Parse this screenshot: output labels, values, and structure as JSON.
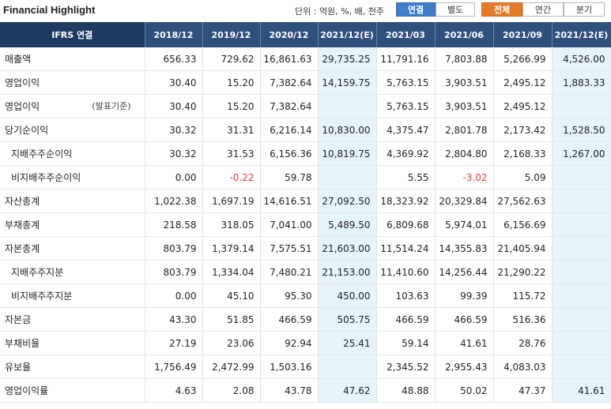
{
  "header": {
    "title": "Financial Highlight",
    "unit": "단위 : 억원, %, 배, 천주",
    "view_tabs": [
      "연결",
      "별도"
    ],
    "period_tabs": [
      "전체",
      "연간",
      "분기"
    ]
  },
  "columns": [
    "IFRS 연결",
    "2018/12",
    "2019/12",
    "2020/12",
    "2021/12(E)",
    "2021/03",
    "2021/06",
    "2021/09",
    "2021/12(E)"
  ],
  "rows": [
    {
      "label": "매출액",
      "note": "",
      "values": [
        "656.33",
        "729.62",
        "16,861.63",
        "29,735.25",
        "11,791.16",
        "7,803.88",
        "5,266.99",
        "4,526.00"
      ]
    },
    {
      "label": "영업이익",
      "note": "",
      "values": [
        "30.40",
        "15.20",
        "7,382.64",
        "14,159.75",
        "5,763.15",
        "3,903.51",
        "2,495.12",
        "1,883.33"
      ]
    },
    {
      "label": "영업이익",
      "note": "(발표기준)",
      "values": [
        "30.40",
        "15.20",
        "7,382.64",
        "",
        "5,763.15",
        "3,903.51",
        "2,495.12",
        ""
      ]
    },
    {
      "label": "당기순이익",
      "note": "",
      "values": [
        "30.32",
        "31.31",
        "6,216.14",
        "10,830.00",
        "4,375.47",
        "2,801.78",
        "2,173.42",
        "1,528.50"
      ]
    },
    {
      "label": "지배주주순이익",
      "note": "",
      "values": [
        "30.32",
        "31.53",
        "6,156.36",
        "10,819.75",
        "4,369.92",
        "2,804.80",
        "2,168.33",
        "1,267.00"
      ]
    },
    {
      "label": "비지배주주순이익",
      "note": "",
      "values": [
        "0.00",
        "-0.22",
        "59.78",
        "",
        "5.55",
        "-3.02",
        "5.09",
        ""
      ]
    },
    {
      "label": "자산총계",
      "note": "",
      "values": [
        "1,022.38",
        "1,697.19",
        "14,616.51",
        "27,092.50",
        "18,323.92",
        "20,329.84",
        "27,562.63",
        ""
      ]
    },
    {
      "label": "부채총계",
      "note": "",
      "values": [
        "218.58",
        "318.05",
        "7,041.00",
        "5,489.50",
        "6,809.68",
        "5,974.01",
        "6,156.69",
        ""
      ]
    },
    {
      "label": "자본총계",
      "note": "",
      "values": [
        "803.79",
        "1,379.14",
        "7,575.51",
        "21,603.00",
        "11,514.24",
        "14,355.83",
        "21,405.94",
        ""
      ]
    },
    {
      "label": "지배주주지분",
      "note": "",
      "values": [
        "803.79",
        "1,334.04",
        "7,480.21",
        "21,153.00",
        "11,410.60",
        "14,256.44",
        "21,290.22",
        ""
      ]
    },
    {
      "label": "비지배주주지분",
      "note": "",
      "values": [
        "0.00",
        "45.10",
        "95.30",
        "450.00",
        "103.63",
        "99.39",
        "115.72",
        ""
      ]
    },
    {
      "label": "자본금",
      "note": "",
      "values": [
        "43.30",
        "51.85",
        "466.59",
        "505.75",
        "466.59",
        "466.59",
        "516.36",
        ""
      ]
    },
    {
      "label": "부채비율",
      "note": "",
      "values": [
        "27.19",
        "23.06",
        "92.94",
        "25.41",
        "59.14",
        "41.61",
        "28.76",
        ""
      ]
    },
    {
      "label": "유보율",
      "note": "",
      "values": [
        "1,756.49",
        "2,472.99",
        "1,503.16",
        "",
        "2,345.52",
        "2,955.43",
        "4,083.03",
        ""
      ]
    },
    {
      "label": "영업이익률",
      "note": "",
      "values": [
        "4.63",
        "2.08",
        "43.78",
        "47.62",
        "48.88",
        "50.02",
        "47.37",
        "41.61"
      ]
    }
  ]
}
